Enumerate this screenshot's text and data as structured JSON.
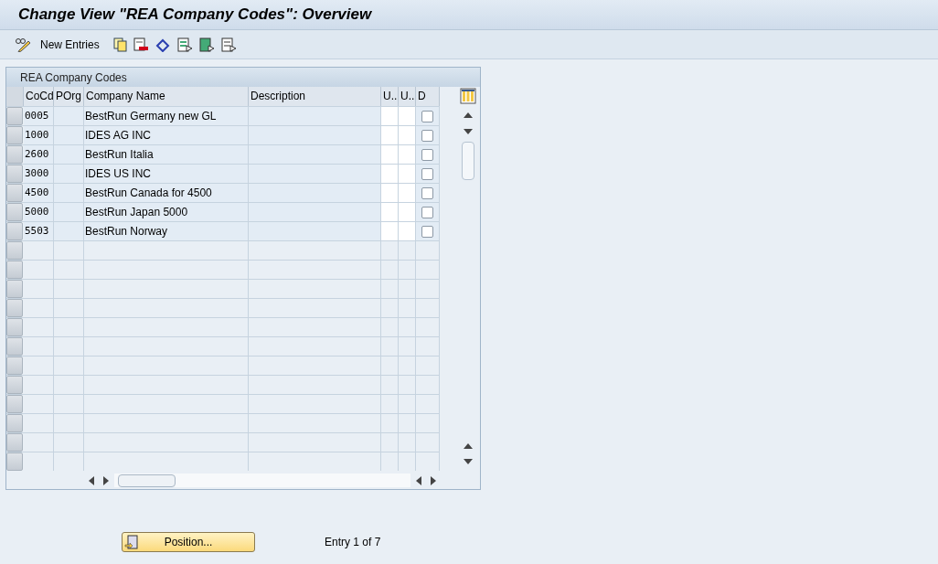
{
  "window": {
    "title": "Change View \"REA Company Codes\": Overview"
  },
  "toolbar": {
    "new_entries": "New Entries"
  },
  "table": {
    "title": "REA Company Codes",
    "columns": [
      "CoCd",
      "POrg",
      "Company Name",
      "Description",
      "U..",
      "U..",
      "D"
    ],
    "rows": [
      {
        "cocd": "0005",
        "name": "BestRun Germany new GL",
        "checked": false
      },
      {
        "cocd": "1000",
        "name": "IDES AG INC",
        "checked": false
      },
      {
        "cocd": "2600",
        "name": "BestRun Italia",
        "checked": false
      },
      {
        "cocd": "3000",
        "name": "IDES US INC",
        "checked": false
      },
      {
        "cocd": "4500",
        "name": "BestRun Canada for 4500",
        "checked": false
      },
      {
        "cocd": "5000",
        "name": "BestRun Japan 5000",
        "checked": false
      },
      {
        "cocd": "5503",
        "name": "BestRun Norway",
        "checked": false
      }
    ]
  },
  "position_button": "Position...",
  "entry_info": "Entry 1 of 7"
}
